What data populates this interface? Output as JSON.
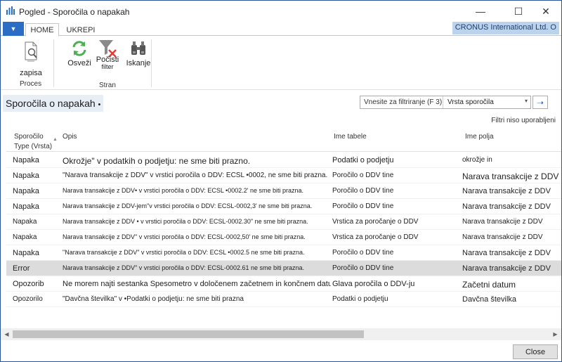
{
  "window": {
    "title": "Pogled - Sporočila o napakah",
    "minimize": "—",
    "maximize": "☐",
    "close": "✕"
  },
  "ribbon": {
    "file_glyph": "▼",
    "tabs": [
      "HOME",
      "UKREPI"
    ],
    "company": "CRONUS International Ltd. O",
    "buttons": {
      "zapisa": "zapisa",
      "osvezi": "Osveži",
      "pocisti": "Počisti",
      "pocisti_sub": "filter",
      "iskanje": "Iskanje"
    },
    "groups": {
      "proces": "Proces",
      "stran": "Stran"
    }
  },
  "page": {
    "title": "Sporočila o napakah",
    "title_marker": "•",
    "filter_hint": "Vnesite za filtriranje (F 3)",
    "filter_field": "Vrsta sporočila",
    "dropdown_glyph": "▾",
    "go_glyph": "➝",
    "no_filters": "Filtri niso uporabljeni"
  },
  "table": {
    "headers": {
      "type_line1": "Sporočilo",
      "type_line2": "Type (Vrsta)",
      "description": "Opis",
      "table_name": "Ime tabele",
      "field_name": "Ime polja"
    },
    "sort_glyph": "▲",
    "rows": [
      {
        "type": "Napaka",
        "description": "Okrožje\" v podatkih o podjetju: ne sme biti prazno.",
        "table": "Podatki o podjetju",
        "field": "okrožje in"
      },
      {
        "type": "Napaka",
        "description": "\"Narava transakcije z DDV\" v vrstici poročila o DDV: ECSL •0002, ne sme biti prazna.",
        "table": "Poročilo o DDV tine",
        "field": "Narava transakcije z DDV"
      },
      {
        "type": "Napaka",
        "description": "Narava transakcije z DDV• v vrstici poročila o DDV: ECSL •0002.2' ne sme biti prazna.",
        "table": "Poročilo o DDV tine",
        "field": "Narava transakcije z DDV"
      },
      {
        "type": "Napaka",
        "description": "Narava transakcije z DDV-jem\"v vrstici poročila o DDV: ECSL-0002,3' ne sme biti prazna.",
        "table": "Poročilo o DDV tine",
        "field": "Narava transakcije z DDV"
      },
      {
        "type": "Napaka",
        "description": "Narava transakcije z DDV • v vrstici poročila o DDV: ECSL-0002.30\" ne sme biti prazna.",
        "table": "Vrstica za poročanje o DDV",
        "field": "Narava transakcije z DDV"
      },
      {
        "type": "Napaka",
        "description": "Narava transakcije z DDV\" v vrstici poročila o DDV: ECSL-0002,50' ne sme biti prazna.",
        "table": "Vrstica za poročanje o DDV",
        "field": "Narava transakcije z DDV"
      },
      {
        "type": "Napaka",
        "description": "\"Narava transakcije z DDV\" v vrstici poročila o DDV: ECSL •0002.5 ne sme biti prazna.",
        "table": "Poročilo o DDV tine",
        "field": "Narava transakcije z DDV"
      },
      {
        "type": "Error",
        "description": "Narava transakcije z DDV\" v vrstici poročila o DDV: ECSL-0002.61 ne sme biti prazna.",
        "table": "Poročilo o DDV tine",
        "field": "Narava transakcije z DDV"
      },
      {
        "type": "Opozorib",
        "description": "Ne morem najti sestanka Spesometro v določenem začetnem in končnem datumu.",
        "table": "Glava poročila o DDV-ju",
        "field": "Začetni datum"
      },
      {
        "type": "Opozorilo",
        "description": "\"Davčna številka\" v •Podatki o podjetju: ne sme biti prazna",
        "table": "Podatki o podjetju",
        "field": "Davčna številka"
      }
    ]
  },
  "scrollbar": {
    "left": "◀",
    "right": "▶"
  },
  "footer": {
    "close": "Close"
  },
  "colors": {
    "accent": "#2b6cc4",
    "selected_row": "#dcdcdc",
    "company_bg": "#bcd3ee"
  }
}
